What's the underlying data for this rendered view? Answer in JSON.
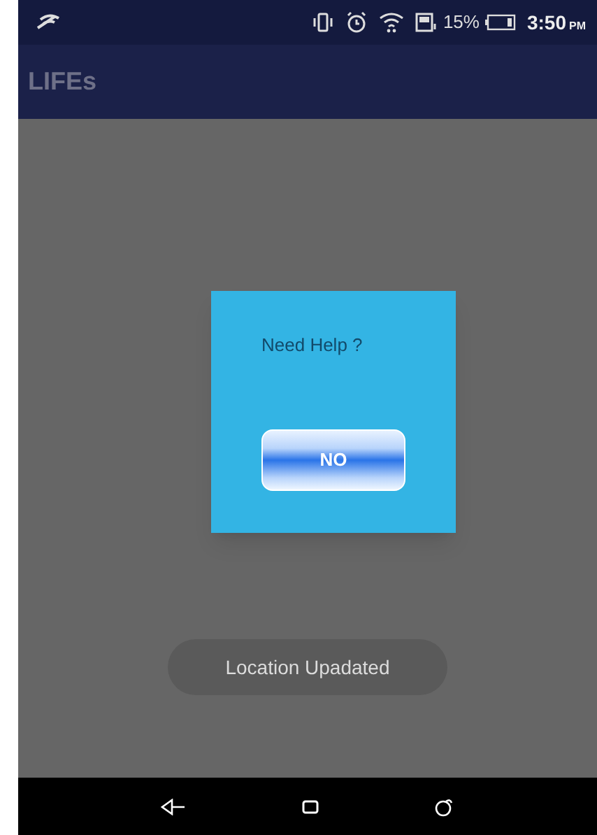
{
  "status_bar": {
    "battery_percent": "15%",
    "time": "3:50",
    "time_suffix": "PM"
  },
  "app_bar": {
    "title": "LIFEs"
  },
  "dialog": {
    "message": "Need Help ?",
    "button": "NO"
  },
  "toast": {
    "text": "Location Upadated"
  }
}
